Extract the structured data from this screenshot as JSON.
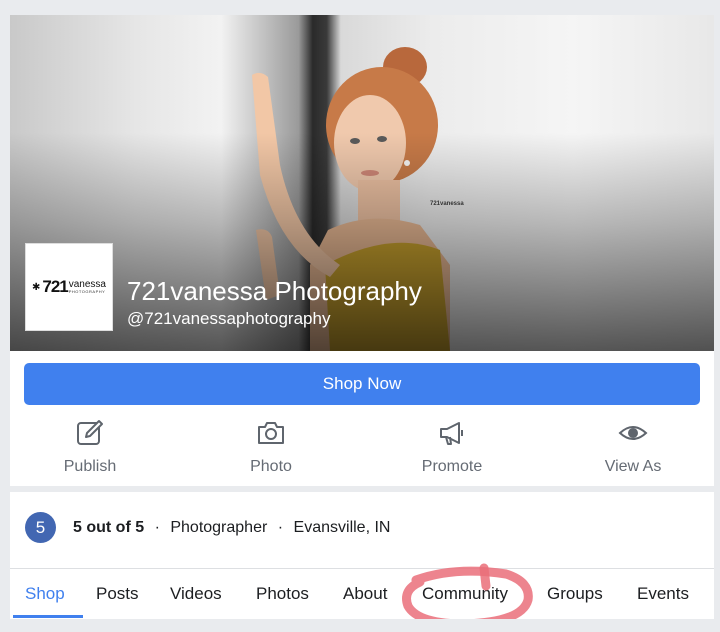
{
  "page": {
    "name": "721vanessa Photography",
    "handle": "@721vanessaphotography",
    "logo": {
      "number": "721",
      "brand": "vanessa",
      "sub": "PHOTOGRAPHY"
    },
    "cover_watermark": "721vanessa"
  },
  "cta": {
    "label": "Shop Now",
    "color": "#4080ee"
  },
  "actions": [
    {
      "label": "Publish",
      "icon": "edit-icon"
    },
    {
      "label": "Photo",
      "icon": "camera-icon"
    },
    {
      "label": "Promote",
      "icon": "megaphone-icon"
    },
    {
      "label": "View As",
      "icon": "eye-icon"
    }
  ],
  "info": {
    "rating_badge": "5",
    "rating_text": "5 out of 5",
    "category": "Photographer",
    "location": "Evansville, IN",
    "separator": "·"
  },
  "tabs": [
    {
      "label": "Shop",
      "active": true
    },
    {
      "label": "Posts"
    },
    {
      "label": "Videos"
    },
    {
      "label": "Photos"
    },
    {
      "label": "About"
    },
    {
      "label": "Community",
      "highlighted": true
    },
    {
      "label": "Groups"
    },
    {
      "label": "Events"
    }
  ],
  "colors": {
    "accent": "#4080ee",
    "highlight_marker": "#ea6f7a",
    "badge": "#4267b2"
  }
}
